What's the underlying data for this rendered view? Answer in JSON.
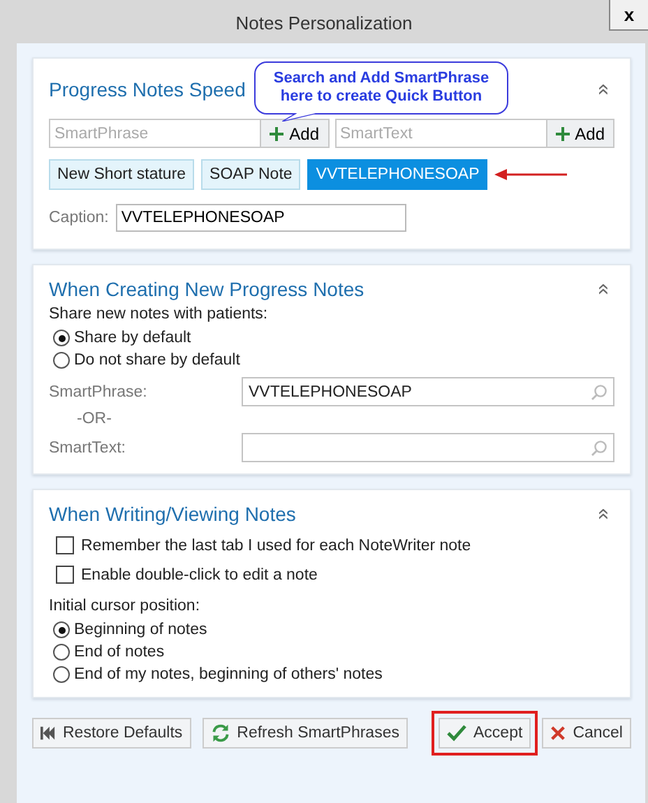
{
  "window": {
    "title": "Notes Personalization",
    "close": "x"
  },
  "speed": {
    "title": "Progress Notes Speed",
    "collapse": "«",
    "callout": "Search and Add SmartPhrase here to create Quick Button",
    "adders": [
      {
        "placeholder": "SmartPhrase",
        "button": "Add"
      },
      {
        "placeholder": "SmartText",
        "button": "Add"
      }
    ],
    "quick_buttons": [
      {
        "label": "New Short stature",
        "selected": false
      },
      {
        "label": "SOAP Note",
        "selected": false
      },
      {
        "label": "VVTELEPHONESOAP",
        "selected": true
      }
    ],
    "caption_label": "Caption:",
    "caption_value": "VVTELEPHONESOAP"
  },
  "creating": {
    "title": "When Creating New Progress Notes",
    "collapse": "«",
    "share_label": "Share new notes with patients:",
    "share_options": [
      {
        "label": "Share by default",
        "selected": true
      },
      {
        "label": "Do not share by default",
        "selected": false
      }
    ],
    "smartphrase_label": "SmartPhrase:",
    "smartphrase_value": "VVTELEPHONESOAP",
    "or": "-OR-",
    "smarttext_label": "SmartText:"
  },
  "writing": {
    "title": "When Writing/Viewing Notes",
    "collapse": "«",
    "checks": [
      {
        "label": "Remember the last tab I used for each NoteWriter note",
        "checked": false
      },
      {
        "label": "Enable double-click to edit a note",
        "checked": false
      }
    ],
    "cursor_label": "Initial cursor position:",
    "cursor_options": [
      {
        "label": "Beginning of notes",
        "selected": true
      },
      {
        "label": "End of notes",
        "selected": false
      },
      {
        "label": "End of my notes, beginning of others' notes",
        "selected": false
      }
    ]
  },
  "buttons": [
    {
      "kind": "restore",
      "label": "Restore Defaults"
    },
    {
      "kind": "refresh",
      "label": "Refresh SmartPhrases"
    },
    {
      "kind": "accept",
      "label": "Accept"
    },
    {
      "kind": "cancel",
      "label": "Cancel"
    }
  ]
}
